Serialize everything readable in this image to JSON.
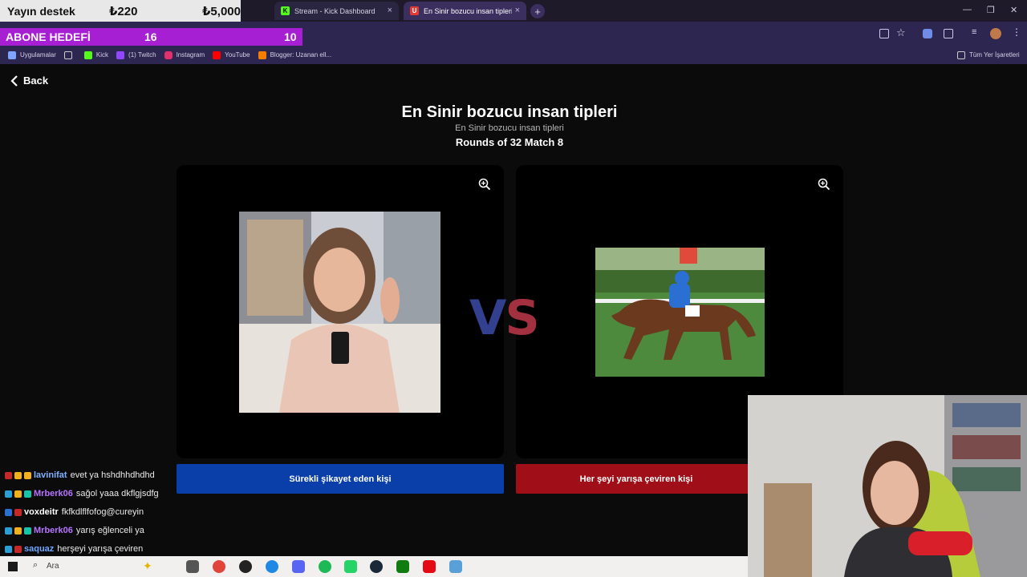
{
  "browser": {
    "tabs": [
      {
        "label": "Stream - Kick Dashboard",
        "favicon": "K",
        "color": "#53fc18"
      },
      {
        "label": "En Sinir bozucu insan tipleri | U",
        "favicon": "U",
        "color": "#e53935"
      }
    ],
    "bookmarks": [
      "Uygulamalar",
      "Kick",
      "(1) Twitch",
      "Instagram",
      "YouTube",
      "Blogger: Uzanan ell...",
      "Tüm Yer İşaretleri"
    ]
  },
  "overlay": {
    "donate_label": "Yayın destek",
    "donate_current": "₺220",
    "donate_goal": "₺5,000",
    "sub_goal_label": "ABONE HEDEFİ",
    "sub_goal_current": "16",
    "sub_goal_target": "10"
  },
  "page": {
    "back_label": "Back",
    "title": "En Sinir bozucu insan tipleri",
    "subtitle": "En Sinir bozucu insan tipleri",
    "round": "Rounds of 32 Match 8",
    "vs_v": "V",
    "vs_s": "S",
    "left_choice": "Sürekli şikayet eden kişi",
    "right_choice": "Her şeyi yarışa çeviren kişi"
  },
  "chat": [
    {
      "user": "lavinifat",
      "msg": "evet ya hshdhhdhdhd",
      "color": "#7fb3ff"
    },
    {
      "user": "Mrberk06",
      "msg": "sağol yaaa dkflgjsdfg",
      "color": "#b673ff"
    },
    {
      "user": "voxdeitr",
      "msg": "fkfkdlflfofog@cureyin",
      "color": "#ffffff"
    },
    {
      "user": "Mrberk06",
      "msg": "yarış eğlenceli ya",
      "color": "#b673ff"
    },
    {
      "user": "saquaz",
      "msg": "herşeyi yarışa çeviren",
      "color": "#6ea8ff"
    }
  ],
  "taskbar": {
    "search_placeholder": "Ara"
  }
}
